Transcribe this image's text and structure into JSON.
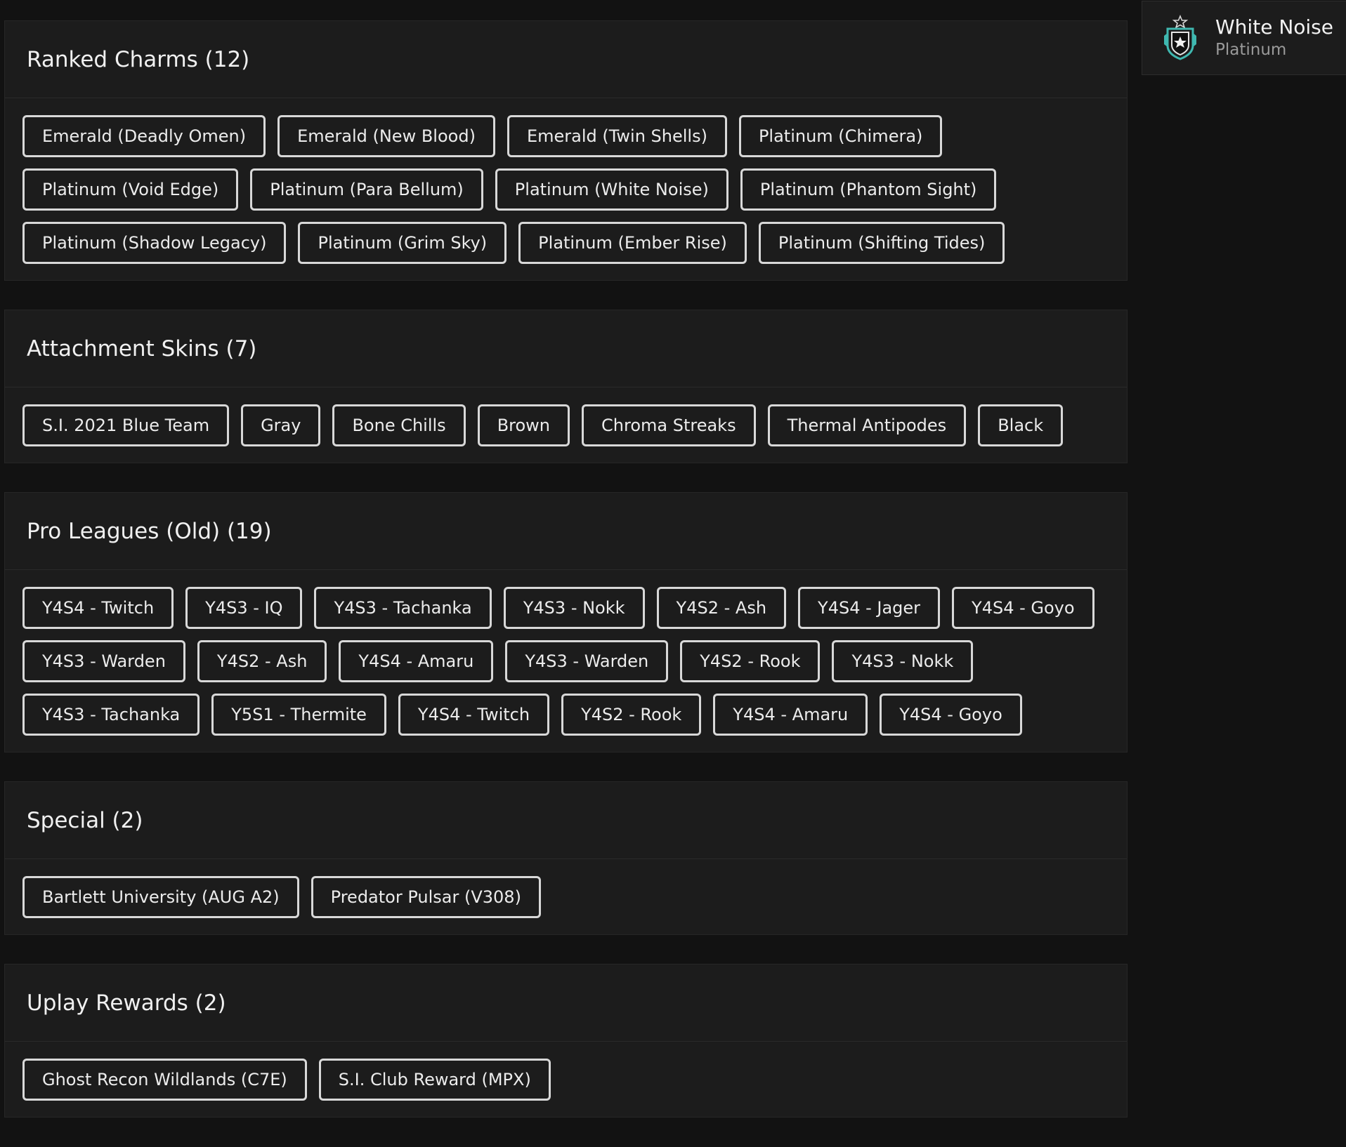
{
  "sections": [
    {
      "title": "Ranked Charms (12)",
      "items": [
        "Emerald (Deadly Omen)",
        "Emerald (New Blood)",
        "Emerald (Twin Shells)",
        "Platinum (Chimera)",
        "Platinum (Void Edge)",
        "Platinum (Para Bellum)",
        "Platinum (White Noise)",
        "Platinum (Phantom Sight)",
        "Platinum (Shadow Legacy)",
        "Platinum (Grim Sky)",
        "Platinum (Ember Rise)",
        "Platinum (Shifting Tides)"
      ]
    },
    {
      "title": "Attachment Skins (7)",
      "items": [
        "S.I. 2021 Blue Team",
        "Gray",
        "Bone Chills",
        "Brown",
        "Chroma Streaks",
        "Thermal Antipodes",
        "Black"
      ]
    },
    {
      "title": "Pro Leagues (Old) (19)",
      "items": [
        "Y4S4 - Twitch",
        "Y4S3 - IQ",
        "Y4S3 - Tachanka",
        "Y4S3 - Nokk",
        "Y4S2 - Ash",
        "Y4S4 - Jager",
        "Y4S4 - Goyo",
        "Y4S3 - Warden",
        "Y4S2 - Ash",
        "Y4S4 - Amaru",
        "Y4S3 - Warden",
        "Y4S2 - Rook",
        "Y4S3 - Nokk",
        "Y4S3 - Tachanka",
        "Y5S1 - Thermite",
        "Y4S4 - Twitch",
        "Y4S2 - Rook",
        "Y4S4 - Amaru",
        "Y4S4 - Goyo"
      ]
    },
    {
      "title": "Special (2)",
      "items": [
        "Bartlett University (AUG A2)",
        "Predator Pulsar (V308)"
      ]
    },
    {
      "title": "Uplay Rewards (2)",
      "items": [
        "Ghost Recon Wildlands (C7E)",
        "S.I. Club Reward (MPX)"
      ]
    }
  ],
  "sidebar": {
    "name": "White Noise",
    "subtitle": "Platinum",
    "icon": "rank-badge-icon",
    "icon_color": "#3fb8b0"
  }
}
